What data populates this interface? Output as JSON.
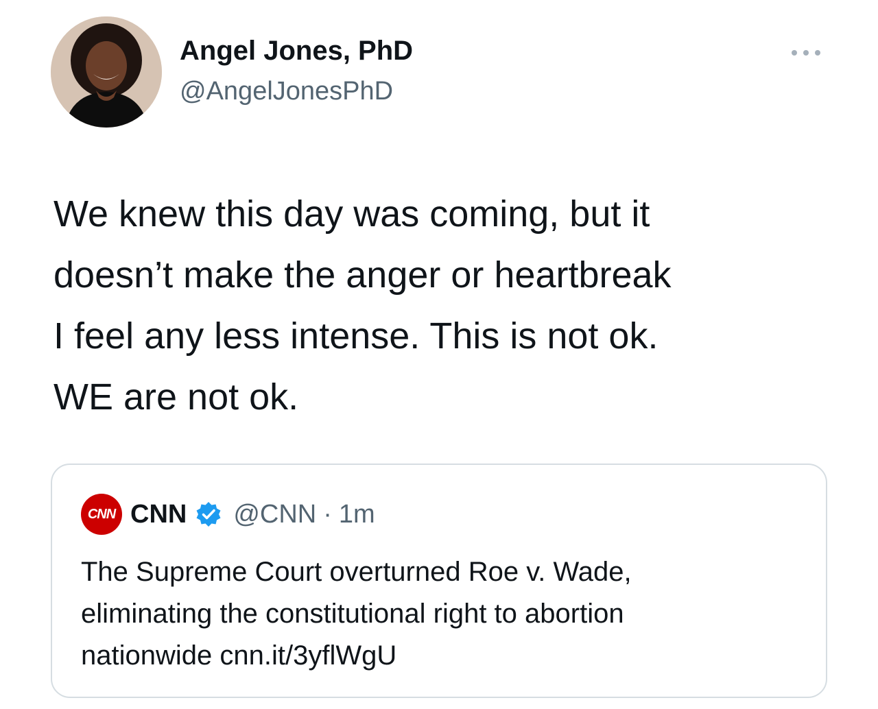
{
  "author": {
    "name": "Angel Jones, PhD",
    "handle": "@AngelJonesPhD"
  },
  "tweet": {
    "text": "We knew this day was coming, but it\ndoesn’t make the anger or heartbreak\nI feel any less intense. This is not ok.\nWE are not ok."
  },
  "quoted_tweet": {
    "logo_text": "CNN",
    "name": "CNN",
    "handle": "@CNN",
    "separator": "·",
    "time": "1m",
    "text": "The Supreme Court overturned Roe v. Wade,\neliminating the constitutional right to abortion\nnationwide cnn.it/3yflWgU"
  },
  "icons": {
    "more": "more-horizontal-icon",
    "verified": "verified-badge-icon"
  },
  "colors": {
    "text_primary": "#0f1419",
    "text_secondary": "#536471",
    "verified_blue": "#1d9bf0",
    "cnn_red": "#cc0000",
    "card_border": "#d6dde2"
  }
}
